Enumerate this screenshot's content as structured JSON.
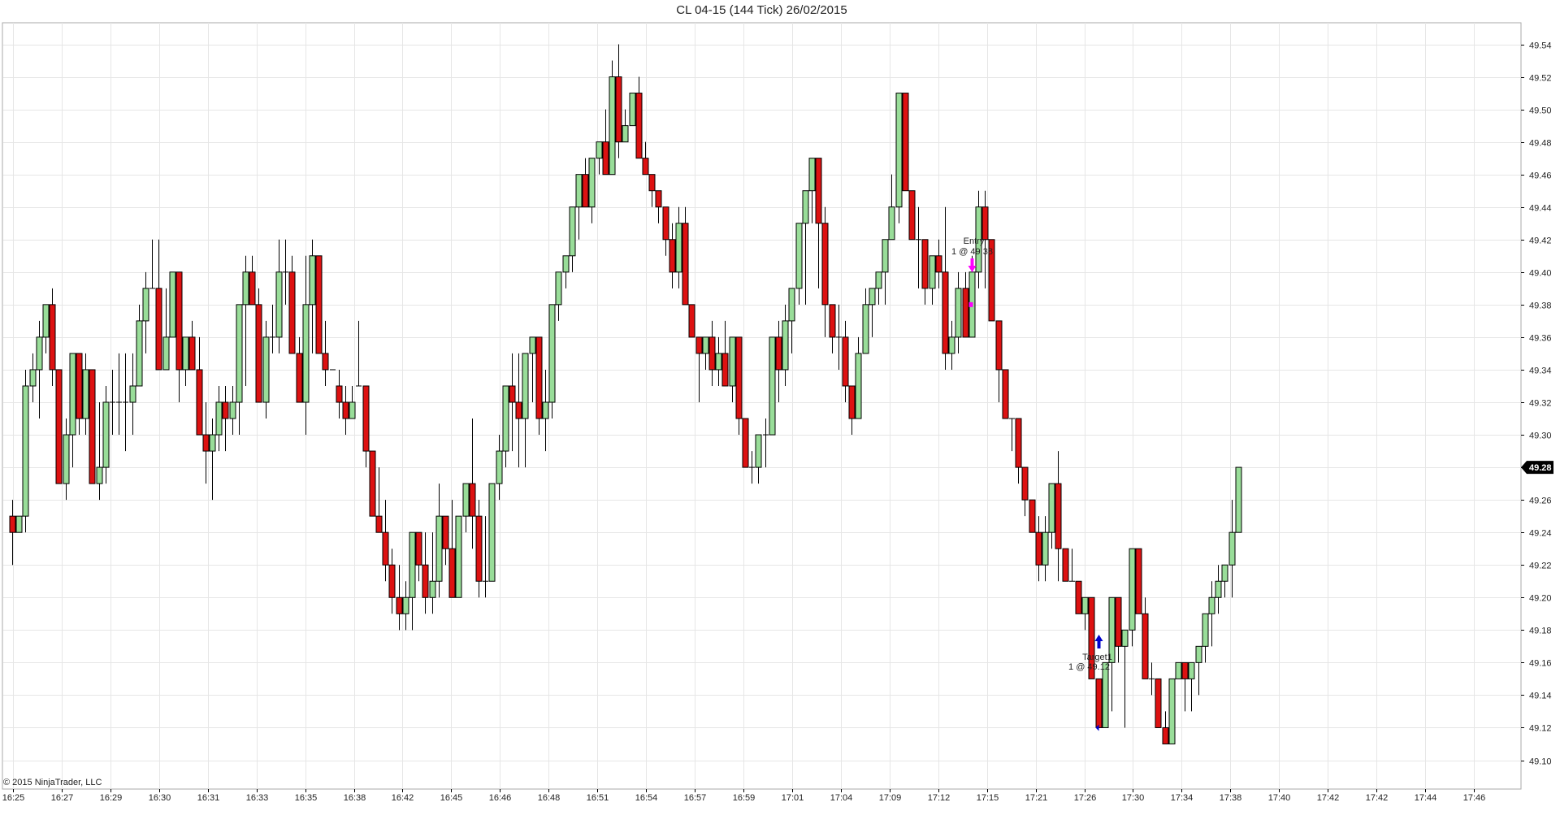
{
  "title": "CL 04-15 (144 Tick)  26/02/2015",
  "copyright": "© 2015 NinjaTrader, LLC",
  "chart_data": {
    "type": "candlestick",
    "instrument": "CL 04-15",
    "interval": "144 Tick",
    "date": "26/02/2015",
    "ylim": [
      49.09,
      49.56
    ],
    "y_ticks": [
      49.1,
      49.12,
      49.14,
      49.16,
      49.18,
      49.2,
      49.22,
      49.24,
      49.26,
      49.28,
      49.3,
      49.32,
      49.34,
      49.36,
      49.38,
      49.4,
      49.42,
      49.44,
      49.46,
      49.48,
      49.5,
      49.52,
      49.54
    ],
    "x_tick_labels": [
      "16:25",
      "16:27",
      "16:29",
      "16:30",
      "16:31",
      "16:33",
      "16:35",
      "16:38",
      "16:42",
      "16:45",
      "16:46",
      "16:48",
      "16:51",
      "16:54",
      "16:57",
      "16:59",
      "17:01",
      "17:04",
      "17:09",
      "17:12",
      "17:15",
      "17:21",
      "17:26",
      "17:30",
      "17:34",
      "17:38",
      "17:40",
      "17:42",
      "17:42",
      "17:44",
      "17:46"
    ],
    "last_price": "49.28",
    "colors": {
      "up": "#99dd99",
      "down": "#dd1111",
      "outline": "#000000",
      "grid": "#e6e6e6",
      "marker_entry": "#ff00ff",
      "marker_target": "#0000cc"
    },
    "candles": [
      [
        49.25,
        49.26,
        49.22,
        49.24
      ],
      [
        49.24,
        49.25,
        49.24,
        49.25
      ],
      [
        49.25,
        49.34,
        49.24,
        49.33
      ],
      [
        49.33,
        49.35,
        49.32,
        49.34
      ],
      [
        49.34,
        49.37,
        49.31,
        49.36
      ],
      [
        49.36,
        49.38,
        49.35,
        49.38
      ],
      [
        49.38,
        49.39,
        49.33,
        49.34
      ],
      [
        49.34,
        49.34,
        49.27,
        49.27
      ],
      [
        49.27,
        49.31,
        49.26,
        49.3
      ],
      [
        49.3,
        49.35,
        49.28,
        49.35
      ],
      [
        49.35,
        49.35,
        49.3,
        49.31
      ],
      [
        49.31,
        49.35,
        49.3,
        49.34
      ],
      [
        49.34,
        49.34,
        49.27,
        49.27
      ],
      [
        49.27,
        49.32,
        49.26,
        49.28
      ],
      [
        49.28,
        49.33,
        49.27,
        49.32
      ],
      [
        49.32,
        49.34,
        49.3,
        49.32
      ],
      [
        49.32,
        49.35,
        49.3,
        49.32
      ],
      [
        49.32,
        49.35,
        49.29,
        49.32
      ],
      [
        49.32,
        49.35,
        49.3,
        49.33
      ],
      [
        49.33,
        49.38,
        49.33,
        49.37
      ],
      [
        49.37,
        49.4,
        49.35,
        49.39
      ],
      [
        49.39,
        49.42,
        49.39,
        49.39
      ],
      [
        49.39,
        49.42,
        49.34,
        49.34
      ],
      [
        49.34,
        49.39,
        49.34,
        49.36
      ],
      [
        49.36,
        49.38,
        49.36,
        49.4
      ],
      [
        49.4,
        49.4,
        49.32,
        49.34
      ],
      [
        49.34,
        49.36,
        49.33,
        49.36
      ],
      [
        49.36,
        49.37,
        49.34,
        49.34
      ],
      [
        49.34,
        49.36,
        49.31,
        49.3
      ],
      [
        49.3,
        49.32,
        49.27,
        49.29
      ],
      [
        49.29,
        49.31,
        49.26,
        49.3
      ],
      [
        49.3,
        49.33,
        49.29,
        49.32
      ],
      [
        49.32,
        49.33,
        49.29,
        49.31
      ],
      [
        49.31,
        49.33,
        49.3,
        49.32
      ],
      [
        49.32,
        49.34,
        49.3,
        49.38
      ],
      [
        49.38,
        49.41,
        49.33,
        49.4
      ],
      [
        49.4,
        49.41,
        49.38,
        49.38
      ],
      [
        49.38,
        49.39,
        49.32,
        49.32
      ],
      [
        49.32,
        49.37,
        49.31,
        49.36
      ],
      [
        49.36,
        49.38,
        49.35,
        49.36
      ],
      [
        49.36,
        49.42,
        49.35,
        49.4
      ],
      [
        49.4,
        49.42,
        49.38,
        49.4
      ],
      [
        49.4,
        49.41,
        49.35,
        49.35
      ],
      [
        49.35,
        49.36,
        49.32,
        49.32
      ],
      [
        49.32,
        49.41,
        49.3,
        49.38
      ],
      [
        49.38,
        49.42,
        49.35,
        49.41
      ],
      [
        49.41,
        49.41,
        49.36,
        49.35
      ],
      [
        49.35,
        49.37,
        49.33,
        49.34
      ],
      [
        49.34,
        49.34,
        49.34,
        49.34
      ],
      [
        49.33,
        49.34,
        49.31,
        49.32
      ],
      [
        49.32,
        49.33,
        49.3,
        49.31
      ],
      [
        49.31,
        49.33,
        49.31,
        49.32
      ],
      [
        49.33,
        49.37,
        49.33,
        49.33
      ],
      [
        49.33,
        49.33,
        49.28,
        49.29
      ],
      [
        49.29,
        49.29,
        49.25,
        49.25
      ],
      [
        49.25,
        49.28,
        49.24,
        49.24
      ],
      [
        49.24,
        49.26,
        49.21,
        49.22
      ],
      [
        49.22,
        49.23,
        49.19,
        49.2
      ],
      [
        49.2,
        49.22,
        49.18,
        49.19
      ],
      [
        49.19,
        49.21,
        49.18,
        49.2
      ],
      [
        49.2,
        49.24,
        49.18,
        49.24
      ],
      [
        49.24,
        49.24,
        49.21,
        49.22
      ],
      [
        49.22,
        49.24,
        49.19,
        49.2
      ],
      [
        49.2,
        49.24,
        49.19,
        49.21
      ],
      [
        49.21,
        49.27,
        49.2,
        49.25
      ],
      [
        49.25,
        49.25,
        49.22,
        49.23
      ],
      [
        49.23,
        49.26,
        49.2,
        49.2
      ],
      [
        49.2,
        49.25,
        49.2,
        49.25
      ],
      [
        49.25,
        49.27,
        49.24,
        49.27
      ],
      [
        49.27,
        49.31,
        49.23,
        49.25
      ],
      [
        49.25,
        49.26,
        49.2,
        49.21
      ],
      [
        49.21,
        49.25,
        49.2,
        49.21
      ],
      [
        49.21,
        49.27,
        49.21,
        49.27
      ],
      [
        49.27,
        49.3,
        49.26,
        49.29
      ],
      [
        49.29,
        49.33,
        49.28,
        49.33
      ],
      [
        49.33,
        49.35,
        49.29,
        49.32
      ],
      [
        49.32,
        49.35,
        49.28,
        49.31
      ],
      [
        49.31,
        49.35,
        49.28,
        49.35
      ],
      [
        49.35,
        49.36,
        49.32,
        49.36
      ],
      [
        49.36,
        49.36,
        49.3,
        49.31
      ],
      [
        49.31,
        49.34,
        49.29,
        49.32
      ],
      [
        49.32,
        49.38,
        49.31,
        49.38
      ],
      [
        49.38,
        49.4,
        49.37,
        49.4
      ],
      [
        49.4,
        49.41,
        49.39,
        49.41
      ],
      [
        49.41,
        49.44,
        49.4,
        49.44
      ],
      [
        49.44,
        49.46,
        49.42,
        49.46
      ],
      [
        49.46,
        49.47,
        49.44,
        49.44
      ],
      [
        49.44,
        49.47,
        49.43,
        49.47
      ],
      [
        49.47,
        49.48,
        49.46,
        49.48
      ],
      [
        49.48,
        49.5,
        49.47,
        49.46
      ],
      [
        49.46,
        49.53,
        49.46,
        49.52
      ],
      [
        49.52,
        49.54,
        49.47,
        49.48
      ],
      [
        49.48,
        49.5,
        49.48,
        49.49
      ],
      [
        49.49,
        49.5,
        49.49,
        49.51
      ],
      [
        49.51,
        49.52,
        49.48,
        49.47
      ],
      [
        49.47,
        49.48,
        49.46,
        49.46
      ],
      [
        49.46,
        49.46,
        49.44,
        49.45
      ],
      [
        49.45,
        49.45,
        49.43,
        49.44
      ],
      [
        49.44,
        49.44,
        49.41,
        49.42
      ],
      [
        49.42,
        49.43,
        49.39,
        49.4
      ],
      [
        49.4,
        49.44,
        49.39,
        49.43
      ],
      [
        49.43,
        49.44,
        49.38,
        49.38
      ],
      [
        49.38,
        49.38,
        49.36,
        49.36
      ],
      [
        49.36,
        49.36,
        49.32,
        49.35
      ],
      [
        49.35,
        49.36,
        49.34,
        49.36
      ],
      [
        49.36,
        49.37,
        49.33,
        49.34
      ],
      [
        49.34,
        49.36,
        49.33,
        49.35
      ],
      [
        49.35,
        49.37,
        49.33,
        49.33
      ],
      [
        49.33,
        49.36,
        49.32,
        49.36
      ],
      [
        49.36,
        49.36,
        49.3,
        49.31
      ],
      [
        49.31,
        49.31,
        49.28,
        49.28
      ],
      [
        49.28,
        49.29,
        49.27,
        49.28
      ],
      [
        49.28,
        49.3,
        49.27,
        49.3
      ],
      [
        49.3,
        49.31,
        49.28,
        49.3
      ],
      [
        49.3,
        49.36,
        49.3,
        49.36
      ],
      [
        49.36,
        49.37,
        49.32,
        49.34
      ],
      [
        49.34,
        49.38,
        49.33,
        49.37
      ],
      [
        49.37,
        49.38,
        49.35,
        49.39
      ],
      [
        49.39,
        49.41,
        49.38,
        49.43
      ],
      [
        49.43,
        49.45,
        49.38,
        49.45
      ],
      [
        49.45,
        49.47,
        49.43,
        49.47
      ],
      [
        49.47,
        49.47,
        49.39,
        49.43
      ],
      [
        49.43,
        49.44,
        49.36,
        49.38
      ],
      [
        49.38,
        49.38,
        49.35,
        49.36
      ],
      [
        49.36,
        49.38,
        49.34,
        49.36
      ],
      [
        49.36,
        49.37,
        49.32,
        49.33
      ],
      [
        49.33,
        49.33,
        49.3,
        49.31
      ],
      [
        49.31,
        49.36,
        49.31,
        49.35
      ],
      [
        49.35,
        49.39,
        49.35,
        49.38
      ],
      [
        49.38,
        49.39,
        49.36,
        49.39
      ],
      [
        49.39,
        49.4,
        49.38,
        49.4
      ],
      [
        49.4,
        49.42,
        49.38,
        49.42
      ],
      [
        49.42,
        49.46,
        49.42,
        49.44
      ],
      [
        49.44,
        49.51,
        49.43,
        49.51
      ],
      [
        49.51,
        49.51,
        49.45,
        49.45
      ],
      [
        49.45,
        49.45,
        49.42,
        49.42
      ],
      [
        49.42,
        49.44,
        49.39,
        49.42
      ],
      [
        49.42,
        49.42,
        49.38,
        49.39
      ],
      [
        49.39,
        49.41,
        49.38,
        49.41
      ],
      [
        49.41,
        49.42,
        49.39,
        49.4
      ],
      [
        49.4,
        49.44,
        49.34,
        49.35
      ],
      [
        49.35,
        49.37,
        49.34,
        49.36
      ],
      [
        49.36,
        49.4,
        49.35,
        49.39
      ],
      [
        49.39,
        49.4,
        49.36,
        49.36
      ],
      [
        49.36,
        49.41,
        49.36,
        49.4
      ],
      [
        49.4,
        49.45,
        49.39,
        49.44
      ],
      [
        49.44,
        49.45,
        49.39,
        49.42
      ],
      [
        49.42,
        49.42,
        49.37,
        49.37
      ],
      [
        49.37,
        49.37,
        49.32,
        49.34
      ],
      [
        49.34,
        49.34,
        49.31,
        49.31
      ],
      [
        49.31,
        49.31,
        49.29,
        49.31
      ],
      [
        49.31,
        49.31,
        49.27,
        49.28
      ],
      [
        49.28,
        49.28,
        49.25,
        49.26
      ],
      [
        49.26,
        49.26,
        49.24,
        49.24
      ],
      [
        49.24,
        49.25,
        49.21,
        49.22
      ],
      [
        49.22,
        49.25,
        49.21,
        49.24
      ],
      [
        49.24,
        49.27,
        49.23,
        49.27
      ],
      [
        49.27,
        49.29,
        49.21,
        49.23
      ],
      [
        49.23,
        49.23,
        49.21,
        49.21
      ],
      [
        49.21,
        49.23,
        49.21,
        49.21
      ],
      [
        49.21,
        49.21,
        49.19,
        49.19
      ],
      [
        49.19,
        49.2,
        49.18,
        49.2
      ],
      [
        49.2,
        49.2,
        49.15,
        49.15
      ],
      [
        49.15,
        49.15,
        49.12,
        49.12
      ],
      [
        49.12,
        49.16,
        49.12,
        49.16
      ],
      [
        49.16,
        49.2,
        49.13,
        49.2
      ],
      [
        49.2,
        49.2,
        49.16,
        49.17
      ],
      [
        49.17,
        49.18,
        49.12,
        49.18
      ],
      [
        49.18,
        49.23,
        49.17,
        49.23
      ],
      [
        49.23,
        49.23,
        49.19,
        49.19
      ],
      [
        49.19,
        49.2,
        49.15,
        49.15
      ],
      [
        49.15,
        49.16,
        49.14,
        49.15
      ],
      [
        49.15,
        49.15,
        49.12,
        49.12
      ],
      [
        49.12,
        49.13,
        49.11,
        49.11
      ],
      [
        49.11,
        49.15,
        49.11,
        49.15
      ],
      [
        49.15,
        49.16,
        49.15,
        49.16
      ],
      [
        49.16,
        49.16,
        49.13,
        49.15
      ],
      [
        49.15,
        49.16,
        49.13,
        49.16
      ],
      [
        49.16,
        49.17,
        49.14,
        49.17
      ],
      [
        49.17,
        49.19,
        49.16,
        49.19
      ],
      [
        49.19,
        49.21,
        49.17,
        49.2
      ],
      [
        49.2,
        49.22,
        49.19,
        49.21
      ],
      [
        49.21,
        49.22,
        49.2,
        49.22
      ],
      [
        49.22,
        49.26,
        49.2,
        49.24
      ],
      [
        49.24,
        49.28,
        49.24,
        49.28
      ]
    ],
    "annotations": [
      {
        "kind": "entry",
        "label": "Entry",
        "detail": "1 @ 49.38",
        "candle_index": 144,
        "price": 49.38
      },
      {
        "kind": "target",
        "label": "Target1",
        "detail": "1 @ 49.12",
        "candle_index": 163,
        "price": 49.12
      }
    ]
  }
}
